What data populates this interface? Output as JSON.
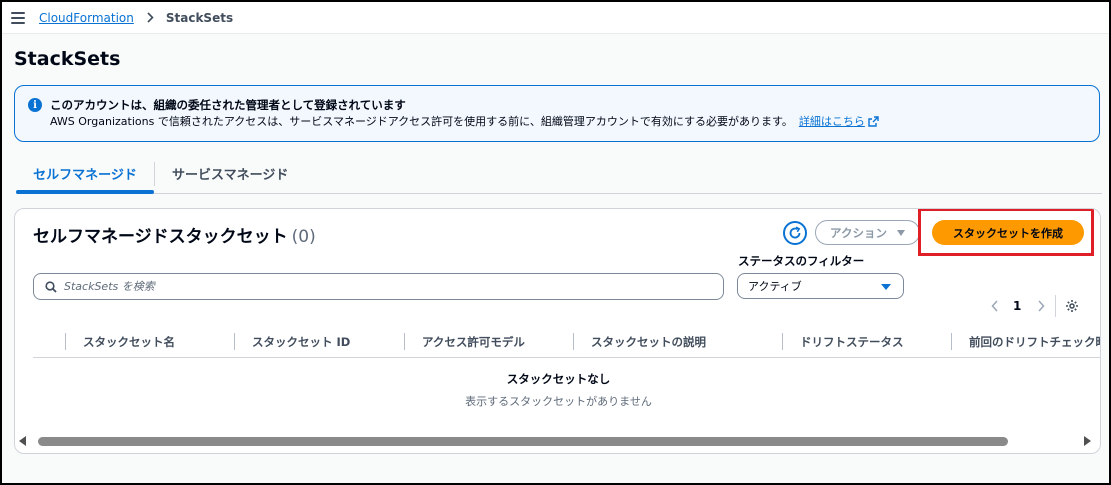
{
  "breadcrumb": {
    "root": "CloudFormation",
    "current": "StackSets"
  },
  "page": {
    "title": "StackSets"
  },
  "banner": {
    "title": "このアカウントは、組織の委任された管理者として登録されています",
    "body": "AWS Organizations で信頼されたアクセスは、サービスマネージドアクセス許可を使用する前に、組織管理アカウントで有効にする必要があります。",
    "link": "詳細はこちら",
    "icon": "info-icon"
  },
  "tabs": [
    {
      "label": "セルフマネージド",
      "active": true
    },
    {
      "label": "サービスマネージド",
      "active": false
    }
  ],
  "panel": {
    "title": "セルフマネージドスタックセット",
    "count": "(0)",
    "actions_label": "アクション",
    "create_label": "スタックセットを作成",
    "filter_label": "ステータスのフィルター",
    "search_placeholder": "StackSets を検索",
    "status_value": "アクティブ",
    "page_number": "1"
  },
  "table": {
    "columns": [
      "スタックセット名",
      "スタックセット ID",
      "アクセス許可モデル",
      "スタックセットの説明",
      "ドリフトステータス",
      "前回のドリフトチェック時"
    ],
    "empty_title": "スタックセットなし",
    "empty_subtitle": "表示するスタックセットがありません"
  },
  "colors": {
    "accent": "#0972d3",
    "primary_button": "#ff9900",
    "highlight": "#e01e26"
  }
}
